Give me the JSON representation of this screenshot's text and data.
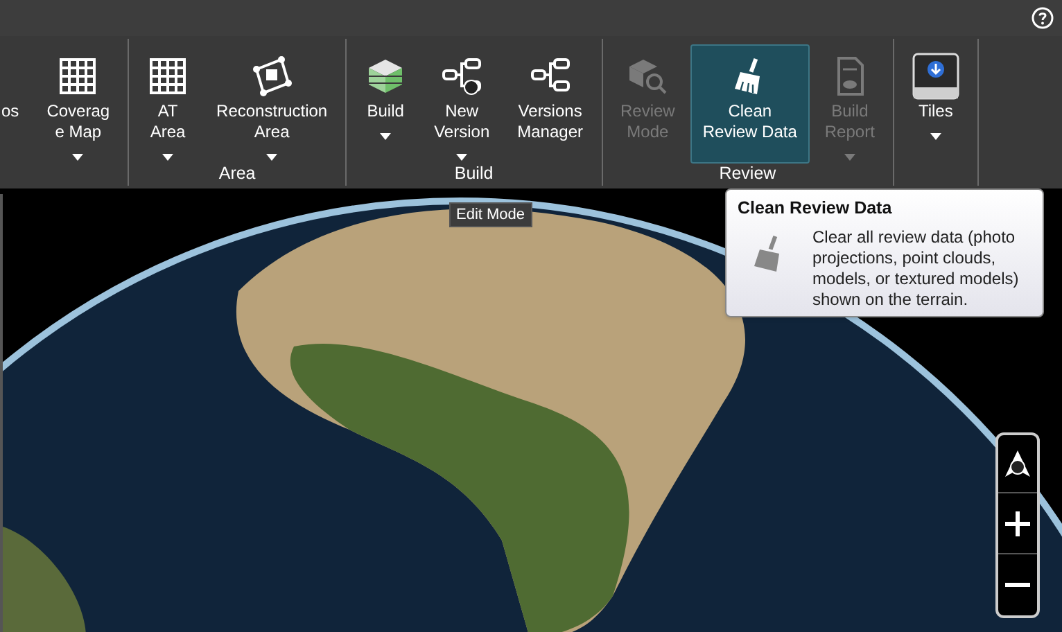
{
  "ribbon": {
    "groups": [
      {
        "buttons": [
          {
            "label": "os",
            "kind": "none",
            "disabled": false,
            "selected": false,
            "dropdown": false
          },
          {
            "label": "Coverag\ne Map",
            "kind": "grid",
            "disabled": false,
            "selected": false,
            "dropdown": true
          }
        ]
      },
      {
        "label": "Area",
        "buttons": [
          {
            "label": "AT\nArea",
            "kind": "grid",
            "disabled": false,
            "selected": false,
            "dropdown": true
          },
          {
            "label": "Reconstruction\nArea",
            "kind": "frame",
            "disabled": false,
            "selected": false,
            "dropdown": true
          }
        ]
      },
      {
        "label": "Build",
        "buttons": [
          {
            "label": "Build",
            "kind": "cube",
            "disabled": false,
            "selected": false,
            "dropdown": true
          },
          {
            "label": "New\nVersion",
            "kind": "tree-new",
            "disabled": false,
            "selected": false,
            "dropdown": true
          },
          {
            "label": "Versions\nManager",
            "kind": "tree",
            "disabled": false,
            "selected": false,
            "dropdown": false
          }
        ]
      },
      {
        "label": "Review",
        "buttons": [
          {
            "label": "Review\nMode",
            "kind": "review",
            "disabled": true,
            "selected": false,
            "dropdown": false
          },
          {
            "label": "Clean\nReview Data",
            "kind": "broom",
            "disabled": false,
            "selected": true,
            "dropdown": false
          },
          {
            "label": "Build\nReport",
            "kind": "report",
            "disabled": true,
            "selected": false,
            "dropdown": true
          }
        ]
      },
      {
        "buttons": [
          {
            "label": "Tiles",
            "kind": "tiles",
            "disabled": false,
            "selected": false,
            "dropdown": true
          }
        ]
      }
    ]
  },
  "mode_tooltip": "Edit Mode",
  "tooltip": {
    "title": "Clean Review Data",
    "text": "Clear all review data (photo projections, point clouds, models, or textured models) shown on the terrain."
  }
}
